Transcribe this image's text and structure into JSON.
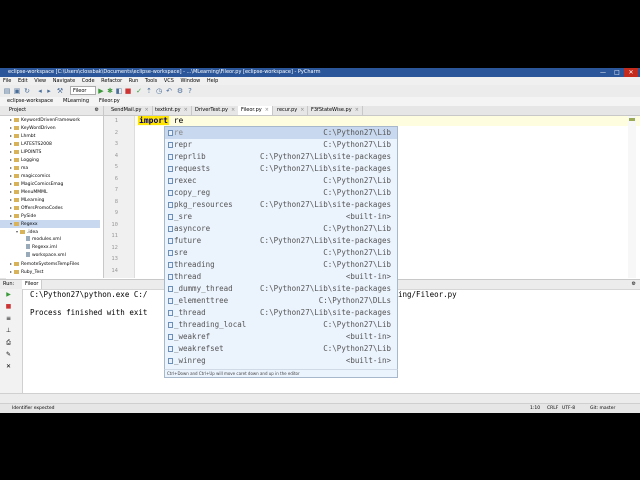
{
  "window": {
    "title": "eclipse-workspace [C:\\Users\\clossbak\\Documents\\eclipse-workspace] - ...\\MLearning\\Fileor.py [eclipse-workspace] - PyCharm",
    "controls": [
      "—",
      "□",
      "✕"
    ]
  },
  "menu": [
    "File",
    "Edit",
    "View",
    "Navigate",
    "Code",
    "Refactor",
    "Run",
    "Tools",
    "VCS",
    "Window",
    "Help"
  ],
  "toolbar": {
    "run_config": "Fileor"
  },
  "breadcrumbs": [
    "eclipse-workspace",
    "MLearning",
    "Fileor.py"
  ],
  "project_panel": {
    "header": "Project",
    "items": [
      {
        "label": "KeywordDrivenFramework",
        "type": "folder"
      },
      {
        "label": "KeyWordDriven",
        "type": "folder"
      },
      {
        "label": "Lhmbt",
        "type": "folder"
      },
      {
        "label": "LATESTS2008",
        "type": "folder"
      },
      {
        "label": "LIPOINTS",
        "type": "folder"
      },
      {
        "label": "Logging",
        "type": "folder"
      },
      {
        "label": "ma",
        "type": "folder"
      },
      {
        "label": "magiccomics",
        "type": "folder"
      },
      {
        "label": "MagicComicsEmag",
        "type": "folder"
      },
      {
        "label": "MenuMMML",
        "type": "folder"
      },
      {
        "label": "MLearning",
        "type": "folder"
      },
      {
        "label": "OffersPromoCodes",
        "type": "folder"
      },
      {
        "label": "PySide",
        "type": "folder"
      },
      {
        "label": "Regexx",
        "type": "folder",
        "selected": true
      },
      {
        "label": ".idea",
        "type": "folder",
        "indent": 1
      },
      {
        "label": "modules.xml",
        "type": "file",
        "indent": 2
      },
      {
        "label": "Regexx.iml",
        "type": "file",
        "indent": 2
      },
      {
        "label": "workspace.xml",
        "type": "file",
        "indent": 2
      },
      {
        "label": "RemoteSystemsTempFiles",
        "type": "folder"
      },
      {
        "label": "Ruby_Test",
        "type": "folder"
      }
    ]
  },
  "tabs": [
    {
      "label": "SendMail.py",
      "active": false
    },
    {
      "label": "textknt.py",
      "active": false
    },
    {
      "label": "DriverTest.py",
      "active": false
    },
    {
      "label": "Fileor.py",
      "active": true
    },
    {
      "label": "recur.py",
      "active": false
    },
    {
      "label": "F3fStateWise.py",
      "active": false
    }
  ],
  "editor": {
    "line_numbers": [
      "1",
      "2",
      "3",
      "4",
      "5",
      "6",
      "7",
      "8",
      "9",
      "10",
      "11",
      "12",
      "13",
      "14"
    ],
    "code_keyword": "import",
    "code_text": " re"
  },
  "autocomplete": {
    "items": [
      {
        "name": "re",
        "location": "C:\\Python27\\Lib"
      },
      {
        "name": "repr",
        "location": "C:\\Python27\\Lib"
      },
      {
        "name": "reprlib",
        "location": "C:\\Python27\\Lib\\site-packages"
      },
      {
        "name": "requests",
        "location": "C:\\Python27\\Lib\\site-packages"
      },
      {
        "name": "rexec",
        "location": "C:\\Python27\\Lib"
      },
      {
        "name": "copy_reg",
        "location": "C:\\Python27\\Lib"
      },
      {
        "name": "pkg_resources",
        "location": "C:\\Python27\\Lib\\site-packages"
      },
      {
        "name": "_sre",
        "location": "<built-in>"
      },
      {
        "name": "asyncore",
        "location": "C:\\Python27\\Lib"
      },
      {
        "name": "future",
        "location": "C:\\Python27\\Lib\\site-packages"
      },
      {
        "name": "sre",
        "location": "C:\\Python27\\Lib"
      },
      {
        "name": "threading",
        "location": "C:\\Python27\\Lib"
      },
      {
        "name": "thread",
        "location": "<built-in>"
      },
      {
        "name": "_dummy_thread",
        "location": "C:\\Python27\\Lib\\site-packages"
      },
      {
        "name": "_elementtree",
        "location": "C:\\Python27\\DLLs"
      },
      {
        "name": "_thread",
        "location": "C:\\Python27\\Lib\\site-packages"
      },
      {
        "name": "_threading_local",
        "location": "C:\\Python27\\Lib"
      },
      {
        "name": "_weakref",
        "location": "<built-in>"
      },
      {
        "name": "_weakrefset",
        "location": "C:\\Python27\\Lib"
      },
      {
        "name": "_winreg",
        "location": "<built-in>"
      }
    ],
    "footer": "Ctrl+Down and Ctrl+Up will move caret down and up in the editor"
  },
  "run_panel": {
    "label": "Run:",
    "tab": "Fileor",
    "cmd_line": "C:\\Python27\\python.exe C:/",
    "cmd_tail": "ing/Fileor.py",
    "finished": "Process finished with exit"
  },
  "status": {
    "message": "Identifier expected",
    "position": "1:10",
    "line_sep": "CRLF",
    "encoding": "UTF-8",
    "vcs": "Git: master"
  }
}
